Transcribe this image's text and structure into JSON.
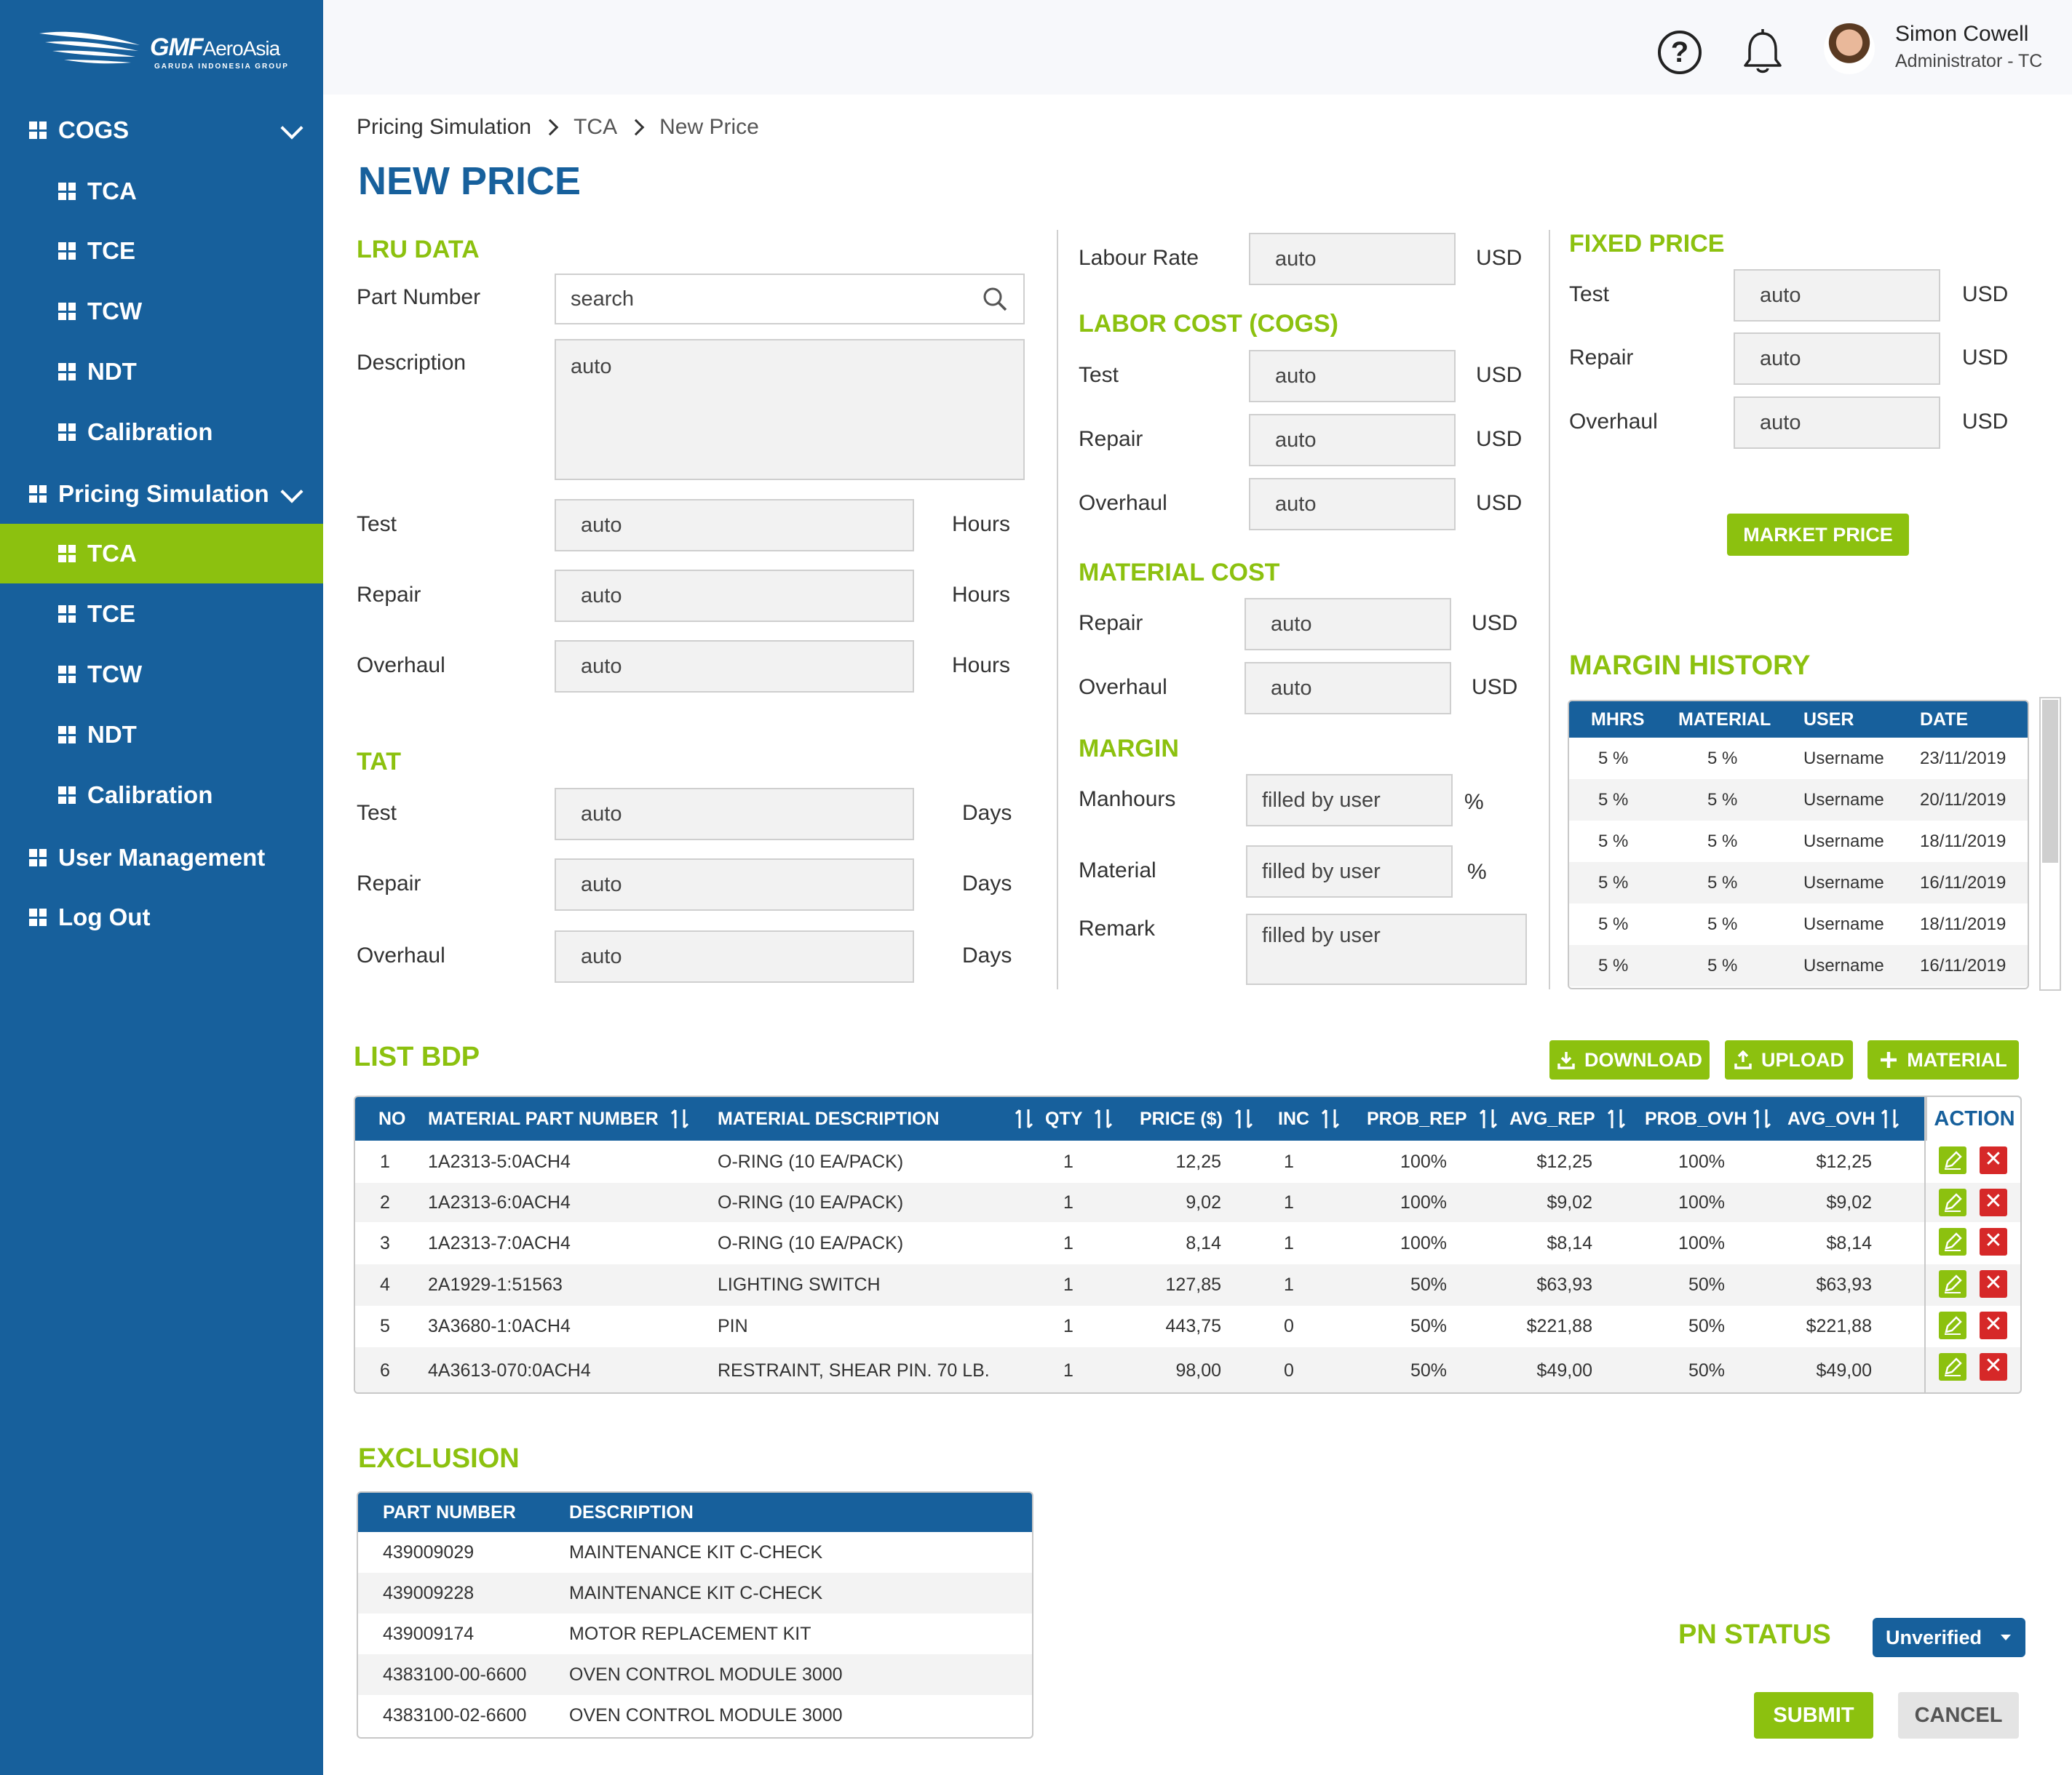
{
  "app": {
    "logo_brand": "GMF",
    "logo_name": "AeroAsia",
    "logo_sub": "GARUDA INDONESIA GROUP"
  },
  "sidebar": {
    "items": [
      {
        "label": "COGS",
        "level": "top",
        "expanded": true
      },
      {
        "label": "TCA",
        "level": "sub"
      },
      {
        "label": "TCE",
        "level": "sub"
      },
      {
        "label": "TCW",
        "level": "sub"
      },
      {
        "label": "NDT",
        "level": "sub"
      },
      {
        "label": "Calibration",
        "level": "sub"
      },
      {
        "label": "Pricing Simulation",
        "level": "top",
        "expanded": true
      },
      {
        "label": "TCA",
        "level": "sub",
        "active": true
      },
      {
        "label": "TCE",
        "level": "sub"
      },
      {
        "label": "TCW",
        "level": "sub"
      },
      {
        "label": "NDT",
        "level": "sub"
      },
      {
        "label": "Calibration",
        "level": "sub"
      },
      {
        "label": "User Management",
        "level": "top"
      },
      {
        "label": "Log Out",
        "level": "top"
      }
    ]
  },
  "header": {
    "user_name": "Simon Cowell",
    "user_role": "Administrator - TC",
    "help_icon": "help-icon",
    "bell_icon": "bell-icon"
  },
  "breadcrumb": [
    "Pricing Simulation",
    "TCA",
    "New Price"
  ],
  "page_title": "NEW PRICE",
  "lru": {
    "title": "LRU DATA",
    "part_number_label": "Part Number",
    "part_number_placeholder": "search",
    "description_label": "Description",
    "description_value": "auto",
    "rows": [
      {
        "label": "Test",
        "value": "auto",
        "unit": "Hours"
      },
      {
        "label": "Repair",
        "value": "auto",
        "unit": "Hours"
      },
      {
        "label": "Overhaul",
        "value": "auto",
        "unit": "Hours"
      }
    ]
  },
  "tat": {
    "title": "TAT",
    "rows": [
      {
        "label": "Test",
        "value": "auto",
        "unit": "Days"
      },
      {
        "label": "Repair",
        "value": "auto",
        "unit": "Days"
      },
      {
        "label": "Overhaul",
        "value": "auto",
        "unit": "Days"
      }
    ]
  },
  "labour_rate": {
    "label": "Labour Rate",
    "value": "auto",
    "unit": "USD"
  },
  "labor_cost": {
    "title": "LABOR COST (COGS)",
    "rows": [
      {
        "label": "Test",
        "value": "auto",
        "unit": "USD"
      },
      {
        "label": "Repair",
        "value": "auto",
        "unit": "USD"
      },
      {
        "label": "Overhaul",
        "value": "auto",
        "unit": "USD"
      }
    ]
  },
  "material_cost": {
    "title": "MATERIAL COST",
    "rows": [
      {
        "label": "Repair",
        "value": "auto",
        "unit": "USD"
      },
      {
        "label": "Overhaul",
        "value": "auto",
        "unit": "USD"
      }
    ]
  },
  "margin": {
    "title": "MARGIN",
    "rows": [
      {
        "label": "Manhours",
        "value": "filled by user",
        "unit": "%"
      },
      {
        "label": "Material",
        "value": "filled by user",
        "unit": "%"
      }
    ],
    "remark_label": "Remark",
    "remark_value": "filled by user"
  },
  "fixed_price": {
    "title": "FIXED PRICE",
    "rows": [
      {
        "label": "Test",
        "value": "auto",
        "unit": "USD"
      },
      {
        "label": "Repair",
        "value": "auto",
        "unit": "USD"
      },
      {
        "label": "Overhaul",
        "value": "auto",
        "unit": "USD"
      }
    ],
    "market_price_button": "MARKET PRICE"
  },
  "margin_history": {
    "title": "MARGIN HISTORY",
    "columns": [
      "MHRS",
      "MATERIAL",
      "USER",
      "DATE"
    ],
    "rows": [
      [
        "5  %",
        "5  %",
        "Username",
        "23/11/2019"
      ],
      [
        "5  %",
        "5  %",
        "Username",
        "20/11/2019"
      ],
      [
        "5  %",
        "5  %",
        "Username",
        "18/11/2019"
      ],
      [
        "5  %",
        "5  %",
        "Username",
        "16/11/2019"
      ],
      [
        "5  %",
        "5  %",
        "Username",
        "18/11/2019"
      ],
      [
        "5  %",
        "5  %",
        "Username",
        "16/11/2019"
      ]
    ]
  },
  "list_bdp": {
    "title": "LIST BDP",
    "download_button": "DOWNLOAD",
    "upload_button": "UPLOAD",
    "material_button": "MATERIAL",
    "columns": [
      "NO",
      "MATERIAL PART NUMBER",
      "MATERIAL DESCRIPTION",
      "QTY",
      "PRICE ($)",
      "INC",
      "PROB_REP",
      "AVG_REP",
      "PROB_OVH",
      "AVG_OVH",
      "ACTION"
    ],
    "rows": [
      [
        "1",
        "1A2313-5:0ACH4",
        "O-RING (10 EA/PACK)",
        "1",
        "12,25",
        "1",
        "100%",
        "$12,25",
        "100%",
        "$12,25"
      ],
      [
        "2",
        "1A2313-6:0ACH4",
        "O-RING (10 EA/PACK)",
        "1",
        "9,02",
        "1",
        "100%",
        "$9,02",
        "100%",
        "$9,02"
      ],
      [
        "3",
        "1A2313-7:0ACH4",
        "O-RING (10 EA/PACK)",
        "1",
        "8,14",
        "1",
        "100%",
        "$8,14",
        "100%",
        "$8,14"
      ],
      [
        "4",
        "2A1929-1:51563",
        "LIGHTING SWITCH",
        "1",
        "127,85",
        "1",
        "50%",
        "$63,93",
        "50%",
        "$63,93"
      ],
      [
        "5",
        "3A3680-1:0ACH4",
        "PIN",
        "1",
        "443,75",
        "0",
        "50%",
        "$221,88",
        "50%",
        "$221,88"
      ],
      [
        "6",
        "4A3613-070:0ACH4",
        "RESTRAINT, SHEAR PIN. 70 LB.",
        "1",
        "98,00",
        "0",
        "50%",
        "$49,00",
        "50%",
        "$49,00"
      ]
    ]
  },
  "exclusion": {
    "title": "EXCLUSION",
    "columns": [
      "PART NUMBER",
      "DESCRIPTION"
    ],
    "rows": [
      [
        "439009029",
        "MAINTENANCE KIT C-CHECK"
      ],
      [
        "439009228",
        "MAINTENANCE KIT C-CHECK"
      ],
      [
        "439009174",
        "MOTOR REPLACEMENT KIT"
      ],
      [
        "4383100-00-6600",
        "OVEN CONTROL MODULE 3000"
      ],
      [
        "4383100-02-6600",
        "OVEN CONTROL MODULE 3000"
      ]
    ]
  },
  "pn_status": {
    "label": "PN STATUS",
    "selected": "Unverified"
  },
  "actions": {
    "submit": "SUBMIT",
    "cancel": "CANCEL"
  },
  "colors": {
    "primary_blue": "#17609c",
    "accent_green": "#8cc10f",
    "danger_red": "#d62828"
  }
}
